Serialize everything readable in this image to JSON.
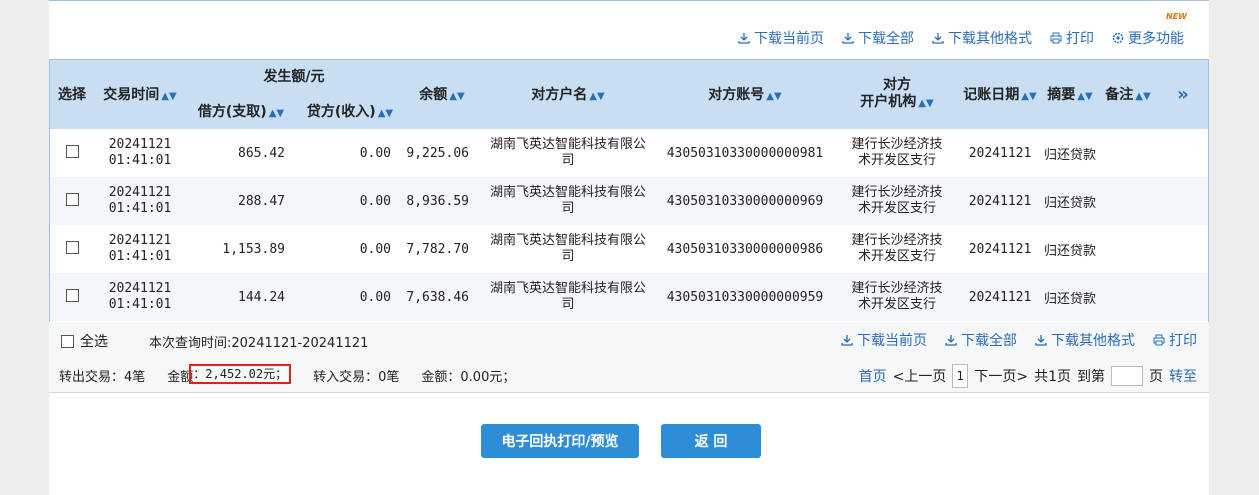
{
  "toolbar": {
    "items": [
      "下载当前页",
      "下载全部",
      "下载其他格式",
      "打印",
      "更多功能"
    ],
    "new_badge": "NEW"
  },
  "table": {
    "headers": {
      "select": "选择",
      "time": "交易时间",
      "amount_group": "发生额/元",
      "debit": "借方(支取)",
      "credit": "贷方(收入)",
      "balance": "余额",
      "counterparty": "对方户名",
      "account": "对方账号",
      "bank_line1": "对方",
      "bank_line2": "开户机构",
      "date": "记账日期",
      "summary": "摘要",
      "remark": "备注",
      "more": "»"
    },
    "rows": [
      {
        "date_line": "20241121",
        "time_line": "01:41:01",
        "debit": "865.42",
        "credit": "0.00",
        "balance": "9,225.06",
        "counterparty": "湖南飞英达智能科技有限公司",
        "account": "43050310330000000981",
        "bank": "建行长沙经济技术开发区支行",
        "post_date": "20241121",
        "summary": "归还贷款",
        "remark": ""
      },
      {
        "date_line": "20241121",
        "time_line": "01:41:01",
        "debit": "288.47",
        "credit": "0.00",
        "balance": "8,936.59",
        "counterparty": "湖南飞英达智能科技有限公司",
        "account": "43050310330000000969",
        "bank": "建行长沙经济技术开发区支行",
        "post_date": "20241121",
        "summary": "归还贷款",
        "remark": ""
      },
      {
        "date_line": "20241121",
        "time_line": "01:41:01",
        "debit": "1,153.89",
        "credit": "0.00",
        "balance": "7,782.70",
        "counterparty": "湖南飞英达智能科技有限公司",
        "account": "43050310330000000986",
        "bank": "建行长沙经济技术开发区支行",
        "post_date": "20241121",
        "summary": "归还贷款",
        "remark": ""
      },
      {
        "date_line": "20241121",
        "time_line": "01:41:01",
        "debit": "144.24",
        "credit": "0.00",
        "balance": "7,638.46",
        "counterparty": "湖南飞英达智能科技有限公司",
        "account": "43050310330000000959",
        "bank": "建行长沙经济技术开发区支行",
        "post_date": "20241121",
        "summary": "归还贷款",
        "remark": ""
      }
    ]
  },
  "footer": {
    "select_all": "全选",
    "query_time": "本次查询时间:20241121-20241121",
    "links": [
      "下载当前页",
      "下载全部",
      "下载其他格式",
      "打印"
    ],
    "out_count": "转出交易：4笔",
    "out_amount_label": "金额",
    "out_amount_value": "：2,452.02元；",
    "in_count": "转入交易：0笔",
    "in_amount": "金额：0.00元；",
    "first": "首页",
    "prev": "<上一页",
    "page": "1",
    "next": "下一页>",
    "total": "共1页",
    "goto_label": "到第",
    "page_suffix": "页",
    "go": "转至"
  },
  "buttons": {
    "print_preview": "电子回执打印/预览",
    "back": "返 回"
  }
}
